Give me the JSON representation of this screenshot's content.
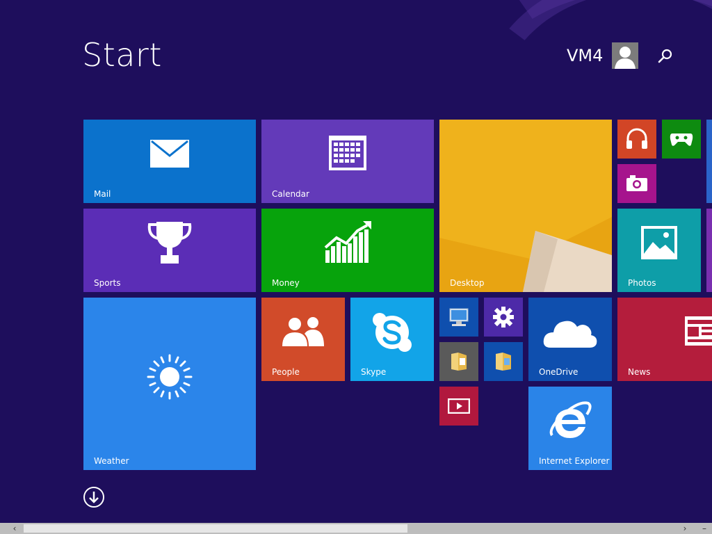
{
  "header": {
    "title": "Start",
    "user_name": "VM4"
  },
  "tiles": {
    "mail": "Mail",
    "calendar": "Calendar",
    "desktop": "Desktop",
    "sports": "Sports",
    "money": "Money",
    "photos": "Photos",
    "weather": "Weather",
    "people": "People",
    "skype": "Skype",
    "onedrive": "OneDrive",
    "news": "News",
    "internet_explorer": "Internet Explorer"
  },
  "small_tiles": [
    "music-icon",
    "games-icon",
    "camera-icon",
    "computer-icon",
    "settings-icon",
    "file-explorer-icon",
    "folder-icon",
    "video-icon"
  ],
  "colors": {
    "background": "#1e0e5c",
    "mail": "#0b72cc",
    "calendar": "#633ab9",
    "desktop": "#e8a412",
    "sports": "#5b2db6",
    "money": "#07a30c",
    "photos": "#0e9ea8",
    "weather": "#2b85ea",
    "people": "#d14b2a",
    "skype": "#12a4e8",
    "onedrive": "#0f4fae",
    "news": "#b41d3c",
    "internet_explorer": "#2a84e8",
    "music": "#d24526",
    "games": "#0e8b10",
    "camera": "#a6148d"
  }
}
